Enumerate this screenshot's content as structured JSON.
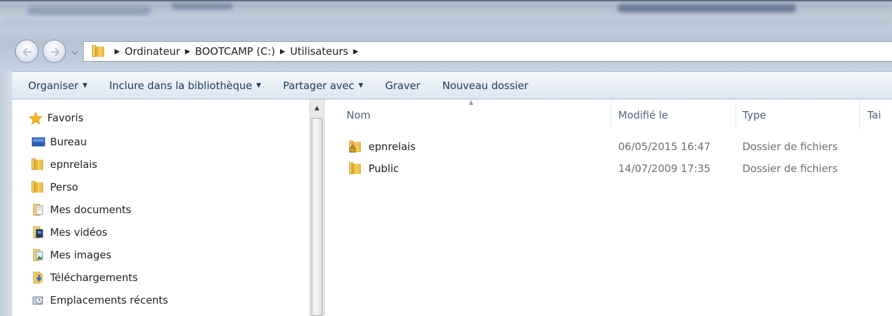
{
  "address_bar": {
    "crumbs": [
      "Ordinateur",
      "BOOTCAMP (C:)",
      "Utilisateurs"
    ]
  },
  "toolbar": {
    "organiser": "Organiser",
    "inclure": "Inclure dans la bibliothèque",
    "partager": "Partager avec",
    "graver": "Graver",
    "nouveau_dossier": "Nouveau dossier"
  },
  "navigation": {
    "favoris": "Favoris",
    "items": [
      {
        "label": "Bureau",
        "icon": "desktop-icon"
      },
      {
        "label": "epnrelais",
        "icon": "folder-icon"
      },
      {
        "label": "Perso",
        "icon": "folder-icon"
      },
      {
        "label": "Mes documents",
        "icon": "documents-icon"
      },
      {
        "label": "Mes vidéos",
        "icon": "videos-icon"
      },
      {
        "label": "Mes images",
        "icon": "images-icon"
      },
      {
        "label": "Téléchargements",
        "icon": "downloads-icon"
      },
      {
        "label": "Emplacements récents",
        "icon": "recent-places-icon"
      }
    ]
  },
  "file_list": {
    "columns": {
      "name": "Nom",
      "modified": "Modifié le",
      "type": "Type",
      "size": "Tai"
    },
    "rows": [
      {
        "name": "epnrelais",
        "modified": "06/05/2015 16:47",
        "type": "Dossier de fichiers",
        "icon": "locked-folder-icon"
      },
      {
        "name": "Public",
        "modified": "14/07/2009 17:35",
        "type": "Dossier de fichiers",
        "icon": "folder-icon"
      }
    ]
  },
  "colors": {
    "toolbar_text": "#1e395b",
    "column_header_text": "#4c607a",
    "secondary_text": "#6d6d6d"
  }
}
